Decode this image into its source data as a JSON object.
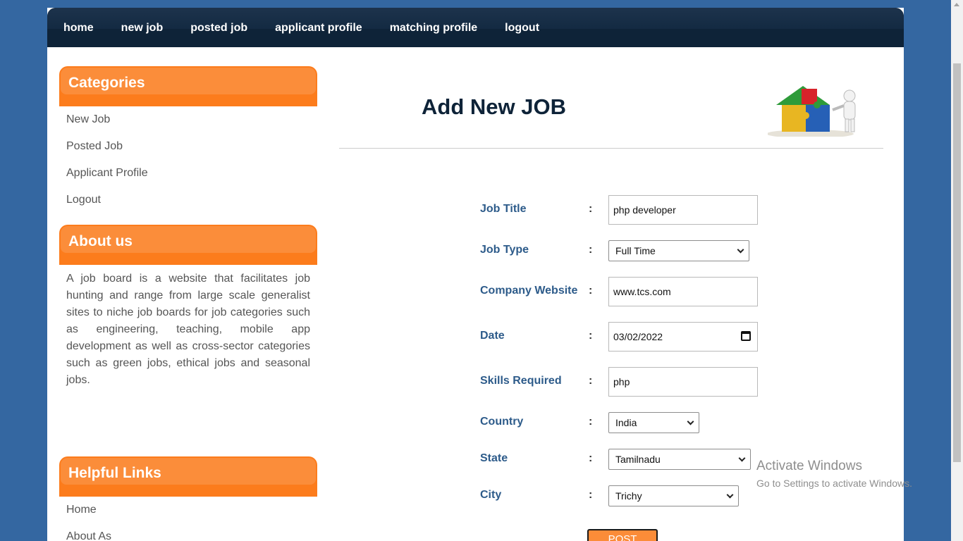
{
  "nav": {
    "items": [
      "home",
      "new job",
      "posted job",
      "applicant profile",
      "matching profile",
      "logout"
    ]
  },
  "sidebar": {
    "categories_title": "Categories",
    "categories": [
      "New Job",
      "Posted Job",
      "Applicant Profile",
      "Logout"
    ],
    "about_title": "About us",
    "about_text": "A job board is a website that facilitates job hunting and range from large scale generalist sites to niche job boards for job categories such as engineering, teaching, mobile app development as well as cross-sector categories such as green jobs, ethical jobs and seasonal jobs.",
    "links_title": "Helpful Links",
    "links": [
      "Home",
      "About As"
    ]
  },
  "main": {
    "title": "Add New JOB",
    "image_icon": "puzzle-house-icon",
    "form": {
      "colon": ":",
      "job_title_label": "Job Title",
      "job_title_value": "php developer",
      "job_type_label": "Job Type",
      "job_type_value": "Full Time",
      "company_website_label": "Company Website",
      "company_website_value": "www.tcs.com",
      "date_label": "Date",
      "date_value": "03/02/2022",
      "skills_label": "Skills Required",
      "skills_value": "php",
      "country_label": "Country",
      "country_value": "India",
      "state_label": "State",
      "state_value": "Tamilnadu",
      "city_label": "City",
      "city_value": "Trichy",
      "post_label": "POST"
    }
  },
  "watermark": {
    "line1": "Activate Windows",
    "line2": "Go to Settings to activate Windows."
  },
  "colors": {
    "navbar": "#0e2338",
    "accent": "#fb8d3a",
    "label": "#2d5b8a",
    "background": "#3467a1"
  }
}
